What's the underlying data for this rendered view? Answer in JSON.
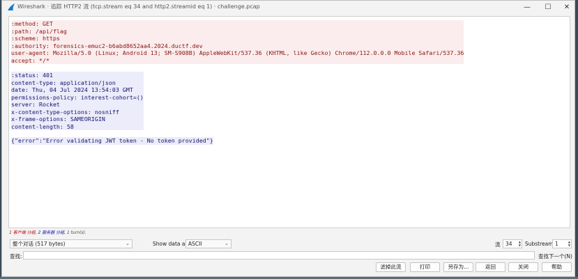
{
  "window": {
    "title": "Wireshark · 追踪 HTTP2 流 (tcp.stream eq 34 and http2.streamid eq 1) · challenge.pcap",
    "minimize_glyph": "—",
    "maximize_glyph": "☐",
    "close_glyph": "✕"
  },
  "request": {
    "lines": [
      ":method: GET",
      ":path: /api/flag",
      ":scheme: https",
      ":authority: forensics-emuc2-b6abd8652aa4.2024.ductf.dev",
      "user-agent: Mozilla/5.0 (Linux; Android 13; SM-S908B) AppleWebKit/537.36 (KHTML, like Gecko) Chrome/112.0.0.0 Mobile Safari/537.36",
      "accept: */*"
    ]
  },
  "response": {
    "lines": [
      ":status: 401",
      "content-type: application/json",
      "date: Thu, 04 Jul 2024 13:54:03 GMT",
      "permissions-policy: interest-cohort=()",
      "server: Rocket",
      "x-content-type-options: nosniff",
      "x-frame-options: SAMEORIGIN",
      "content-length: 58"
    ],
    "body": "{\"error\":\"Error validating JWT token - No token provided\"}"
  },
  "summary": {
    "client_count": "1 客户端 分组",
    "server_count": "2 服务器 分组",
    "turns": "1 turn(s)."
  },
  "controls": {
    "conversation_select": "整个对话 (517 bytes)",
    "show_data_label": "Show data as",
    "show_data_value": "ASCII",
    "stream_label": "流",
    "stream_value": "34",
    "substream_label": "Substream",
    "substream_value": "1",
    "find_label": "查找:",
    "find_value": "",
    "find_next_label": "查找下一个(N)"
  },
  "buttons": {
    "filter_out": "滤掉此流",
    "print": "打印",
    "save_as": "另存为...",
    "back": "返回",
    "close": "关闭",
    "help": "帮助"
  }
}
